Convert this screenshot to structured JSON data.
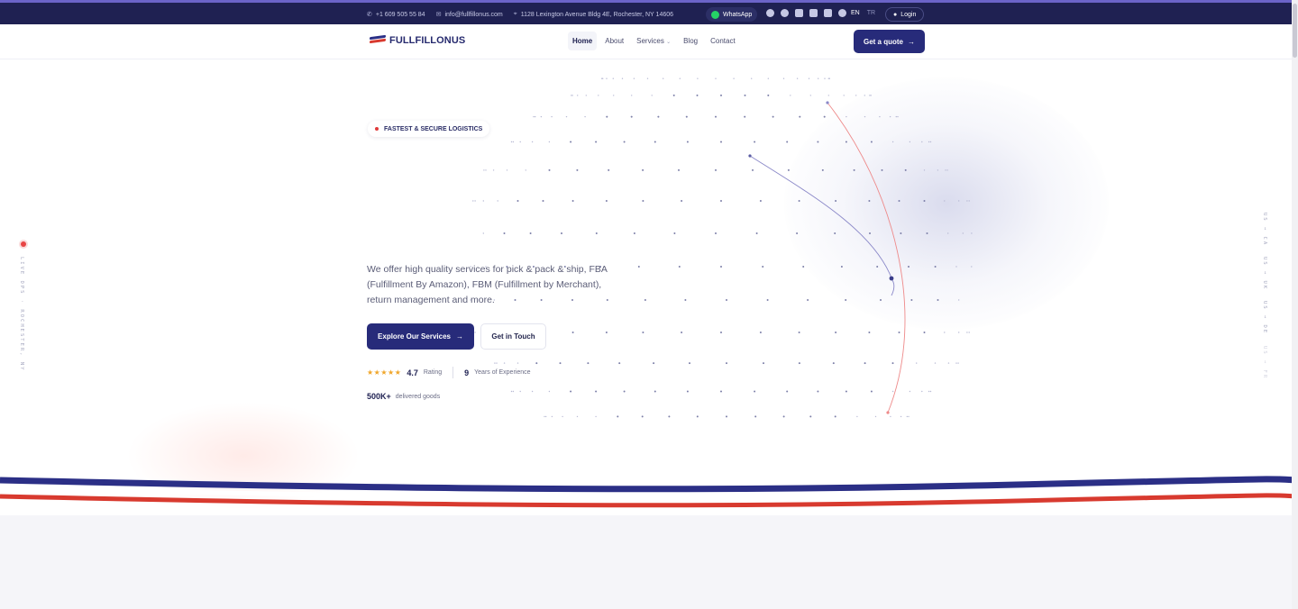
{
  "topbar": {
    "phone": "+1 609 505 55 84",
    "email": "info@fullfillonus.com",
    "address": "1128 Lexington Avenue Bldg 4E, Rochester, NY 14606",
    "whatsapp_label": "WhatsApp",
    "social_icons": [
      "instagram-icon",
      "facebook-icon",
      "x-icon",
      "youtube-icon",
      "tiktok-icon",
      "pinterest-icon"
    ],
    "lang_active": "EN",
    "lang_other": "TR",
    "login_label": "Login"
  },
  "nav": {
    "logo_text": "FULLFILLONUS",
    "items": [
      {
        "label": "Home",
        "active": true
      },
      {
        "label": "About",
        "active": false
      },
      {
        "label": "Services",
        "active": false,
        "has_dropdown": true
      },
      {
        "label": "Blog",
        "active": false
      },
      {
        "label": "Contact",
        "active": false
      }
    ],
    "cta_label": "Get a quote"
  },
  "hero": {
    "badge": "FASTEST & SECURE LOGISTICS",
    "lead": "We offer high quality services for pick & pack & ship, FBA (Fulfillment By Amazon), FBM (Fulfillment by Merchant), return management and more.",
    "primary_button": "Explore Our Services",
    "secondary_button": "Get in Touch",
    "rating_stars": "★★★★★",
    "rating_value": "4.7",
    "rating_label": "Rating",
    "experience_value": "9",
    "experience_label": "Years of Experience",
    "delivered_value": "500K+",
    "delivered_label": "delivered goods"
  },
  "side_left": {
    "text": "LIVE OPS · ROCHESTER, NY"
  },
  "routes": [
    {
      "label": "US → CA"
    },
    {
      "label": "US → UK"
    },
    {
      "label": "US → DE"
    },
    {
      "label": "US → FR"
    }
  ],
  "colors": {
    "navy": "#1f2152",
    "brand": "#272b7a",
    "accent_red": "#e03b3b",
    "flag_blue": "#2b2f86",
    "flag_red": "#d83a2f"
  }
}
